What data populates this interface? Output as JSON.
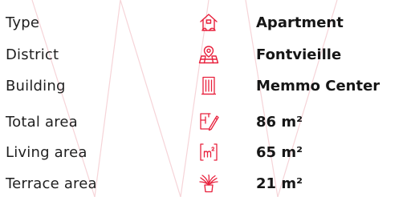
{
  "accent_color": "#e8203c",
  "properties": [
    {
      "label": "Type",
      "icon": "house-icon",
      "value": "Apartment"
    },
    {
      "label": "District",
      "icon": "map-pin-icon",
      "value": "Fontvieille"
    },
    {
      "label": "Building",
      "icon": "building-icon",
      "value": "Memmo Center"
    },
    {
      "label": "Total area",
      "icon": "floor-plan-icon",
      "value": "86 m²"
    },
    {
      "label": "Living area",
      "icon": "square-meters-icon",
      "value": "65 m²"
    },
    {
      "label": "Terrace area",
      "icon": "plant-icon",
      "value": "21 m²"
    }
  ]
}
